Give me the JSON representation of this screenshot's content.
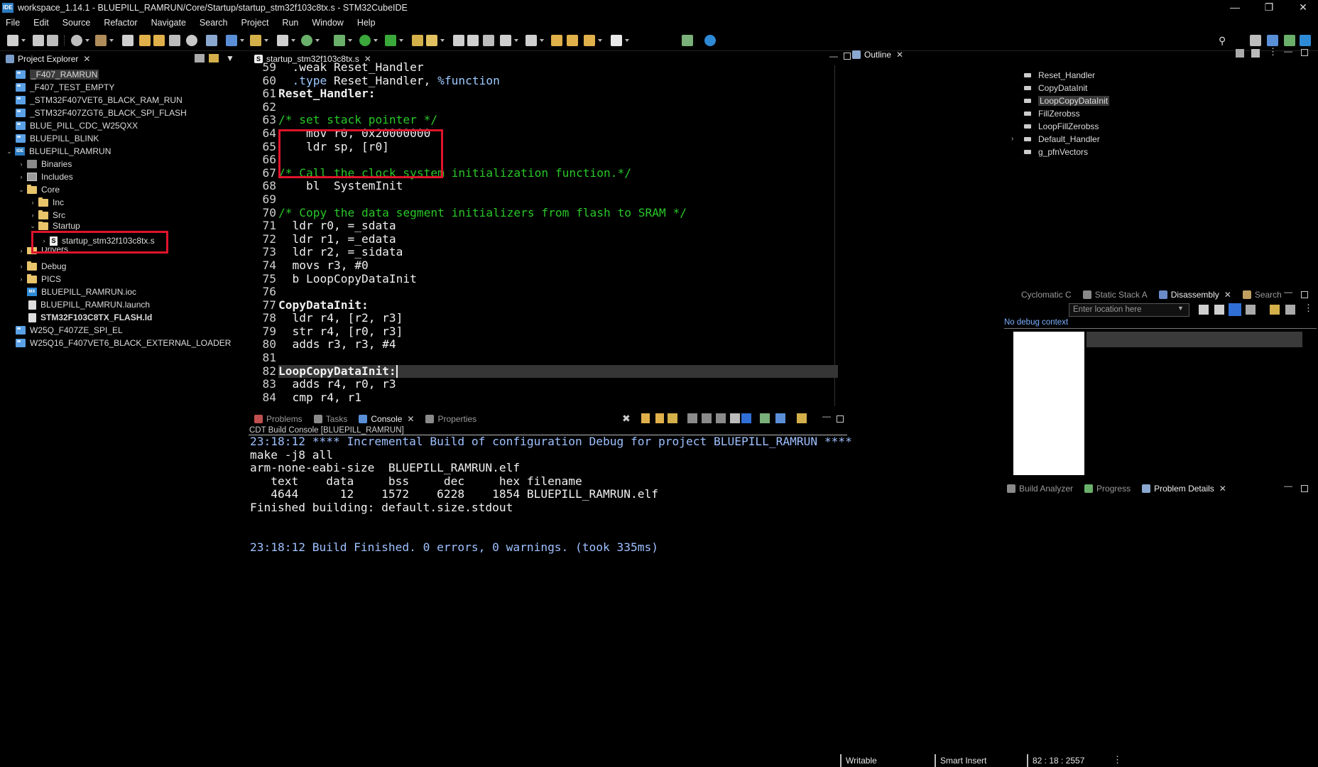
{
  "window": {
    "title": "workspace_1.14.1 - BLUEPILL_RAMRUN/Core/Startup/startup_stm32f103c8tx.s - STM32CubeIDE",
    "app_icon": "IDE"
  },
  "menu": [
    "File",
    "Edit",
    "Source",
    "Refactor",
    "Navigate",
    "Search",
    "Project",
    "Run",
    "Window",
    "Help"
  ],
  "explorer": {
    "tab_label": "Project Explorer",
    "items": [
      {
        "label": "_F407_RAMRUN",
        "icon": "project-icon"
      },
      {
        "label": "_F407_TEST_EMPTY",
        "icon": "project-icon"
      },
      {
        "label": "_STM32F407VET6_BLACK_RAM_RUN",
        "icon": "project-icon"
      },
      {
        "label": "_STM32F407ZGT6_BLACK_SPI_FLASH",
        "icon": "project-icon"
      },
      {
        "label": "BLUE_PILL_CDC_W25QXX",
        "icon": "project-icon"
      },
      {
        "label": "BLUEPILL_BLINK",
        "icon": "project-icon"
      },
      {
        "label": "BLUEPILL_RAMRUN",
        "icon": "ide-project-icon"
      },
      {
        "label": "Binaries",
        "icon": "binaries-icon"
      },
      {
        "label": "Includes",
        "icon": "includes-icon"
      },
      {
        "label": "Core",
        "icon": "folder-icon"
      },
      {
        "label": "Inc",
        "icon": "folder-icon"
      },
      {
        "label": "Src",
        "icon": "folder-icon"
      },
      {
        "label": "Startup",
        "icon": "folder-icon"
      },
      {
        "label": "startup_stm32f103c8tx.s",
        "icon": "asm-file-icon"
      },
      {
        "label": "Drivers",
        "icon": "folder-icon"
      },
      {
        "label": "Debug",
        "icon": "folder-icon"
      },
      {
        "label": "PICS",
        "icon": "folder-icon"
      },
      {
        "label": "BLUEPILL_RAMRUN.ioc",
        "icon": "mx-file-icon"
      },
      {
        "label": "BLUEPILL_RAMRUN.launch",
        "icon": "file-icon"
      },
      {
        "label": "STM32F103C8TX_FLASH.ld",
        "icon": "file-icon"
      },
      {
        "label": "W25Q_F407ZE_SPI_EL",
        "icon": "project-icon"
      },
      {
        "label": "W25Q16_F407VET6_BLACK_EXTERNAL_LOADER",
        "icon": "project-icon"
      }
    ]
  },
  "editor": {
    "tab_label": "startup_stm32f103c8tx.s",
    "lines": [
      {
        "n": "59",
        "text": "  .weak Reset_Handler"
      },
      {
        "n": "60",
        "pre": "  ",
        "kw": ".type",
        "post": " Reset_Handler, ",
        "kw2": "%function"
      },
      {
        "n": "61",
        "text": "Reset_Handler:"
      },
      {
        "n": "62",
        "text": ""
      },
      {
        "n": "63",
        "text": "/* set stack pointer */"
      },
      {
        "n": "64",
        "text": "    mov r0, 0x20000000"
      },
      {
        "n": "65",
        "text": "    ldr sp, [r0]"
      },
      {
        "n": "66",
        "text": ""
      },
      {
        "n": "67",
        "text": "/* Call the clock system initialization function.*/"
      },
      {
        "n": "68",
        "text": "    bl  SystemInit"
      },
      {
        "n": "69",
        "text": ""
      },
      {
        "n": "70",
        "text": "/* Copy the data segment initializers from flash to SRAM */"
      },
      {
        "n": "71",
        "text": "  ldr r0, =_sdata"
      },
      {
        "n": "72",
        "text": "  ldr r1, =_edata"
      },
      {
        "n": "73",
        "text": "  ldr r2, =_sidata"
      },
      {
        "n": "74",
        "text": "  movs r3, #0"
      },
      {
        "n": "75",
        "text": "  b LoopCopyDataInit"
      },
      {
        "n": "76",
        "text": ""
      },
      {
        "n": "77",
        "text": "CopyDataInit:"
      },
      {
        "n": "78",
        "text": "  ldr r4, [r2, r3]"
      },
      {
        "n": "79",
        "text": "  str r4, [r0, r3]"
      },
      {
        "n": "80",
        "text": "  adds r3, r3, #4"
      },
      {
        "n": "81",
        "text": ""
      },
      {
        "n": "82",
        "text": "LoopCopyDataInit:"
      },
      {
        "n": "83",
        "text": "  adds r4, r0, r3"
      },
      {
        "n": "84",
        "text": "  cmp r4, r1"
      }
    ]
  },
  "outline": {
    "tab_label": "Outline",
    "items": [
      "Reset_Handler",
      "CopyDataInit",
      "LoopCopyDataInit",
      "FillZerobss",
      "LoopFillZerobss",
      "Default_Handler",
      "g_pfnVectors"
    ]
  },
  "right_middle": {
    "tabs": [
      "Cyclomatic C",
      "Static Stack A",
      "Disassembly",
      "Search"
    ],
    "location_placeholder": "Enter location here",
    "no_context": "No debug context"
  },
  "right_bottom": {
    "tabs": [
      "Build Analyzer",
      "Progress",
      "Problem Details"
    ]
  },
  "console": {
    "tabs": [
      "Problems",
      "Tasks",
      "Console",
      "Properties"
    ],
    "subtitle": "CDT Build Console [BLUEPILL_RAMRUN]",
    "lines": [
      {
        "text": "23:18:12 **** Incremental Build of configuration Debug for project BLUEPILL_RAMRUN ****",
        "style": "blue"
      },
      {
        "text": "make -j8 all",
        "style": "normal"
      },
      {
        "text": "arm-none-eabi-size  BLUEPILL_RAMRUN.elf",
        "style": "normal"
      },
      {
        "text": "   text    data     bss     dec     hex filename",
        "style": "normal"
      },
      {
        "text": "   4644      12    1572    6228    1854 BLUEPILL_RAMRUN.elf",
        "style": "normal"
      },
      {
        "text": "Finished building: default.size.stdout",
        "style": "normal"
      },
      {
        "text": "",
        "style": "normal"
      },
      {
        "text": "",
        "style": "normal"
      },
      {
        "text": "23:18:12 Build Finished. 0 errors, 0 warnings. (took 335ms)",
        "style": "blue"
      }
    ]
  },
  "statusbar": {
    "writable": "Writable",
    "insert_mode": "Smart Insert",
    "position": "82 : 18 : 2557"
  },
  "colors": {
    "background": "#000000",
    "comment": "#29c729",
    "keyword": "#9ec9ff",
    "console_info": "#9ec0ff",
    "highlight_box": "#e0142b",
    "current_line": "#353535"
  }
}
